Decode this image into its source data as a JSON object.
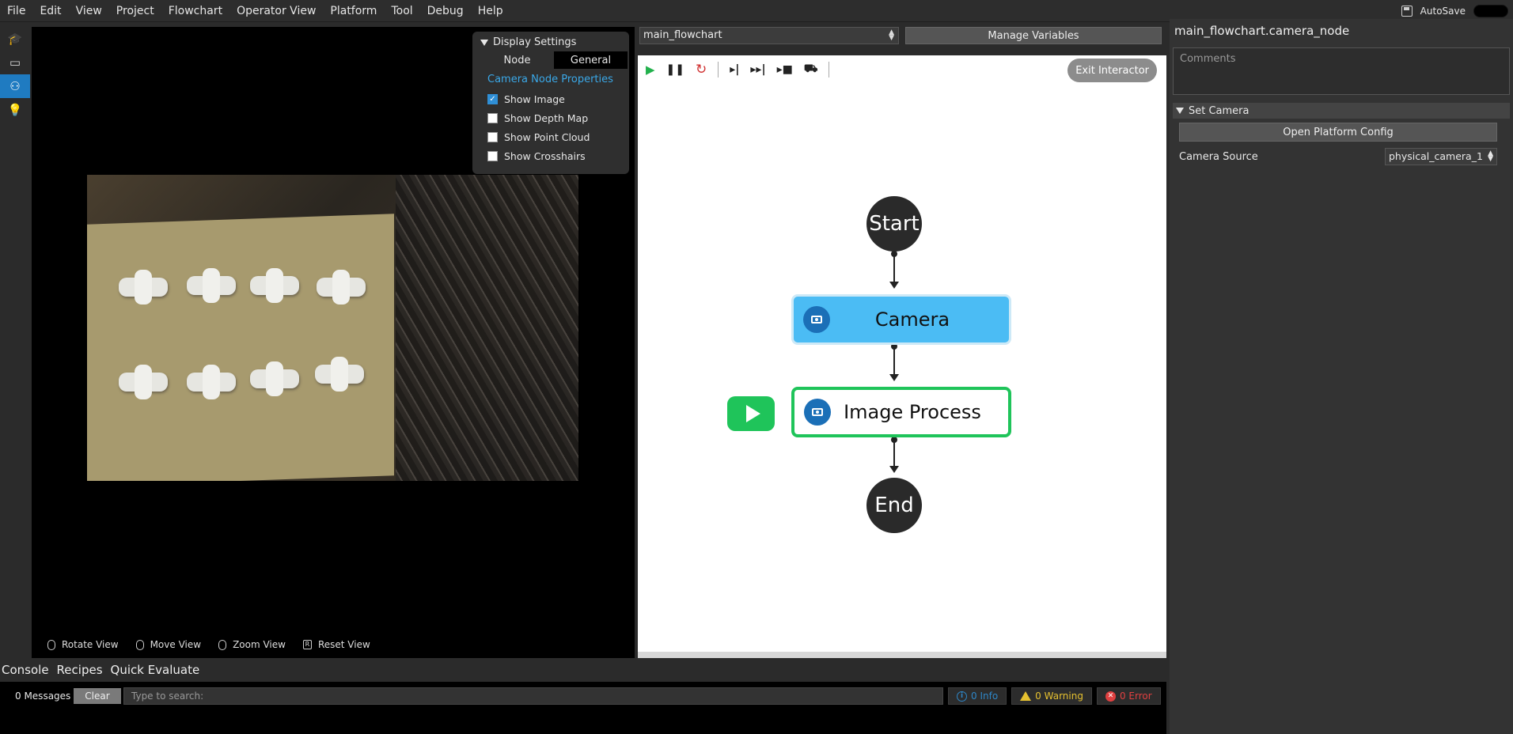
{
  "menu": [
    "File",
    "Edit",
    "View",
    "Project",
    "Flowchart",
    "Operator View",
    "Platform",
    "Tool",
    "Debug",
    "Help"
  ],
  "autosave_label": "AutoSave",
  "sidebar": {
    "icons": [
      "graduation-cap-icon",
      "monitor-icon",
      "flowchart-icon",
      "lightbulb-icon"
    ],
    "active_index": 2
  },
  "viewer": {
    "display_settings": {
      "title": "Display Settings",
      "tabs": [
        "Node",
        "General"
      ],
      "selected_tab": "General",
      "section_title": "Camera Node Properties",
      "options": [
        {
          "label": "Show Image",
          "checked": true
        },
        {
          "label": "Show Depth Map",
          "checked": false
        },
        {
          "label": "Show Point Cloud",
          "checked": false
        },
        {
          "label": "Show Crosshairs",
          "checked": false
        }
      ]
    },
    "footer": [
      {
        "label": "Rotate View",
        "key": ""
      },
      {
        "label": "Move View",
        "key": ""
      },
      {
        "label": "Zoom View",
        "key": ""
      },
      {
        "label": "Reset View",
        "key": "R"
      }
    ]
  },
  "flowchart": {
    "selected": "main_flowchart",
    "manage_variables": "Manage Variables",
    "exit_interactor": "Exit Interactor",
    "toolbar": [
      "play-icon",
      "pause-icon",
      "restart-icon",
      "step-icon",
      "fast-forward-icon",
      "step-into-icon",
      "camera-step-icon"
    ],
    "nodes": {
      "start": "Start",
      "camera": "Camera",
      "image_process": "Image Process",
      "end": "End"
    },
    "colors": {
      "camera_fill": "#4bbcf4",
      "process_border": "#1fc45a",
      "run_badge": "#1fc45a"
    }
  },
  "properties": {
    "title": "main_flowchart.camera_node",
    "comments_placeholder": "Comments",
    "section": "Set Camera",
    "open_platform_config": "Open Platform Config",
    "camera_source_label": "Camera Source",
    "camera_source_value": "physical_camera_1"
  },
  "console": {
    "tabs": [
      "Console",
      "Recipes",
      "Quick Evaluate"
    ],
    "selected_tab": "Console",
    "messages": "0 Messages",
    "clear": "Clear",
    "search_placeholder": "Type to search:",
    "info": "0 Info",
    "warning": "0 Warning",
    "error": "0 Error"
  }
}
